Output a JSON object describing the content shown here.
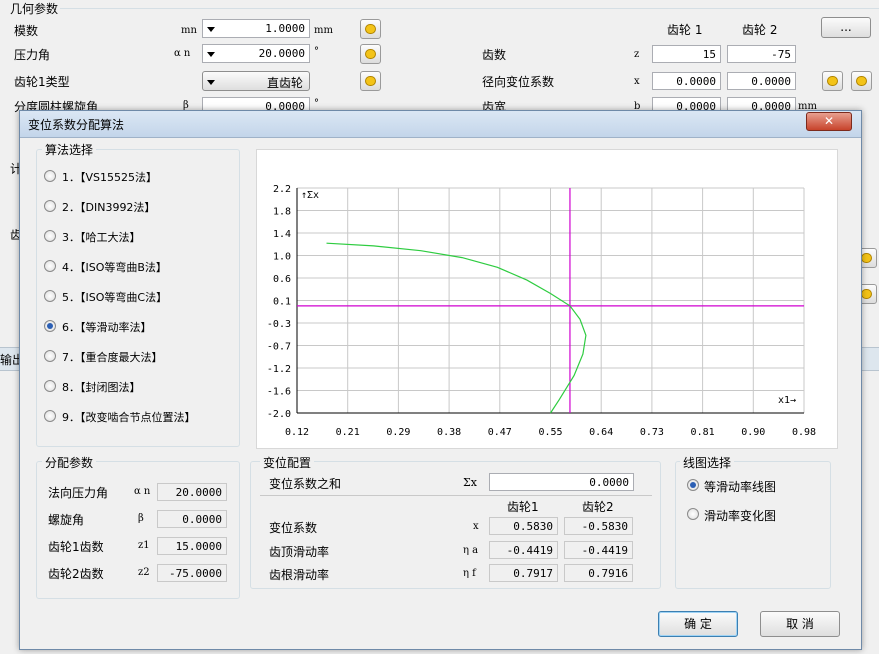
{
  "background": {
    "section_title": "几何参数",
    "module_label": "模数",
    "module_symbol": "mn",
    "module_value": "1.0000",
    "module_unit": "mm",
    "pressure_label": "压力角",
    "pressure_symbol": "α n",
    "pressure_value": "20.0000",
    "pressure_unit": "°",
    "gear1_type_label": "齿轮1类型",
    "gear1_type_value": "直齿轮",
    "helix_label": "分度圆柱螺旋角",
    "helix_symbol": "β",
    "helix_value": "0.0000",
    "helix_unit": "°",
    "gear1_header": "齿轮 1",
    "gear2_header": "齿轮 2",
    "more_button": "...",
    "teeth_label": "齿数",
    "teeth_symbol": "z",
    "teeth_z1": "15",
    "teeth_z2": "-75",
    "shift_label": "径向变位系数",
    "shift_symbol": "x",
    "shift_x1": "0.0000",
    "shift_x2": "0.0000",
    "width_label": "齿宽",
    "width_symbol": "b",
    "width_b1": "0.0000",
    "width_b2": "0.0000",
    "width_unit": "mm",
    "side_fragments": [
      "计",
      "齿",
      "输出"
    ]
  },
  "dialog": {
    "title": "变位系数分配算法",
    "close_label": "✕",
    "algorithm_group": "算法选择",
    "algorithms": [
      {
        "label": "1．【VS15525法】",
        "selected": false
      },
      {
        "label": "2．【DIN3992法】",
        "selected": false
      },
      {
        "label": "3．【哈工大法】",
        "selected": false
      },
      {
        "label": "4．【ISO等弯曲B法】",
        "selected": false
      },
      {
        "label": "5．【ISO等弯曲C法】",
        "selected": false
      },
      {
        "label": "6．【等滑动率法】",
        "selected": true
      },
      {
        "label": "7．【重合度最大法】",
        "selected": false
      },
      {
        "label": "8．【封闭图法】",
        "selected": false
      },
      {
        "label": "9．【改变啮合节点位置法】",
        "selected": false
      }
    ],
    "distribution_group": "分配参数",
    "dist": {
      "normal_pressure_label": "法向压力角",
      "normal_pressure_symbol": "α n",
      "normal_pressure_value": "20.0000",
      "helix_label": "螺旋角",
      "helix_symbol": "β",
      "helix_value": "0.0000",
      "z1_label": "齿轮1齿数",
      "z1_symbol": "z1",
      "z1_value": "15.0000",
      "z2_label": "齿轮2齿数",
      "z2_symbol": "z2",
      "z2_value": "-75.0000"
    },
    "config_group": "变位配置",
    "config": {
      "sum_label": "变位系数之和",
      "sum_symbol": "Σx",
      "sum_value": "0.0000",
      "gear1_header": "齿轮1",
      "gear2_header": "齿轮2",
      "shift_label": "变位系数",
      "shift_symbol": "x",
      "shift_x1": "0.5830",
      "shift_x2": "-0.5830",
      "tip_label": "齿顶滑动率",
      "tip_symbol": "η a",
      "tip_1": "-0.4419",
      "tip_2": "-0.4419",
      "root_label": "齿根滑动率",
      "root_symbol": "η f",
      "root_1": "0.7917",
      "root_2": "0.7916"
    },
    "plot_group": "线图选择",
    "plot_options": [
      {
        "label": "等滑动率线图",
        "selected": true
      },
      {
        "label": "滑动率变化图",
        "selected": false
      }
    ],
    "ok_button": "确  定",
    "cancel_button": "取  消"
  },
  "chart_data": {
    "type": "line",
    "ylabel": "↑Σx",
    "xlabel": "x1→",
    "x_ticks": [
      "0.12",
      "0.21",
      "0.29",
      "0.38",
      "0.47",
      "0.55",
      "0.64",
      "0.73",
      "0.81",
      "0.90",
      "0.98"
    ],
    "y_ticks": [
      "2.2",
      "1.8",
      "1.4",
      "1.0",
      "0.6",
      "0.1",
      "-0.3",
      "-0.7",
      "-1.2",
      "-1.6",
      "-2.0"
    ],
    "xlim": [
      0.12,
      0.98
    ],
    "ylim": [
      -2.0,
      2.2
    ],
    "grid": true,
    "series": [
      {
        "color": "#2ecc40",
        "points": [
          [
            0.17,
            1.17
          ],
          [
            0.25,
            1.12
          ],
          [
            0.33,
            1.03
          ],
          [
            0.4,
            0.9
          ],
          [
            0.46,
            0.72
          ],
          [
            0.51,
            0.48
          ],
          [
            0.55,
            0.23
          ],
          [
            0.583,
            0.0
          ],
          [
            0.6,
            -0.25
          ],
          [
            0.61,
            -0.55
          ],
          [
            0.605,
            -0.9
          ],
          [
            0.59,
            -1.3
          ],
          [
            0.565,
            -1.75
          ],
          [
            0.55,
            -2.0
          ]
        ]
      }
    ],
    "crosshair": {
      "x": 0.583,
      "y": 0.0,
      "color": "#d000d0"
    }
  }
}
